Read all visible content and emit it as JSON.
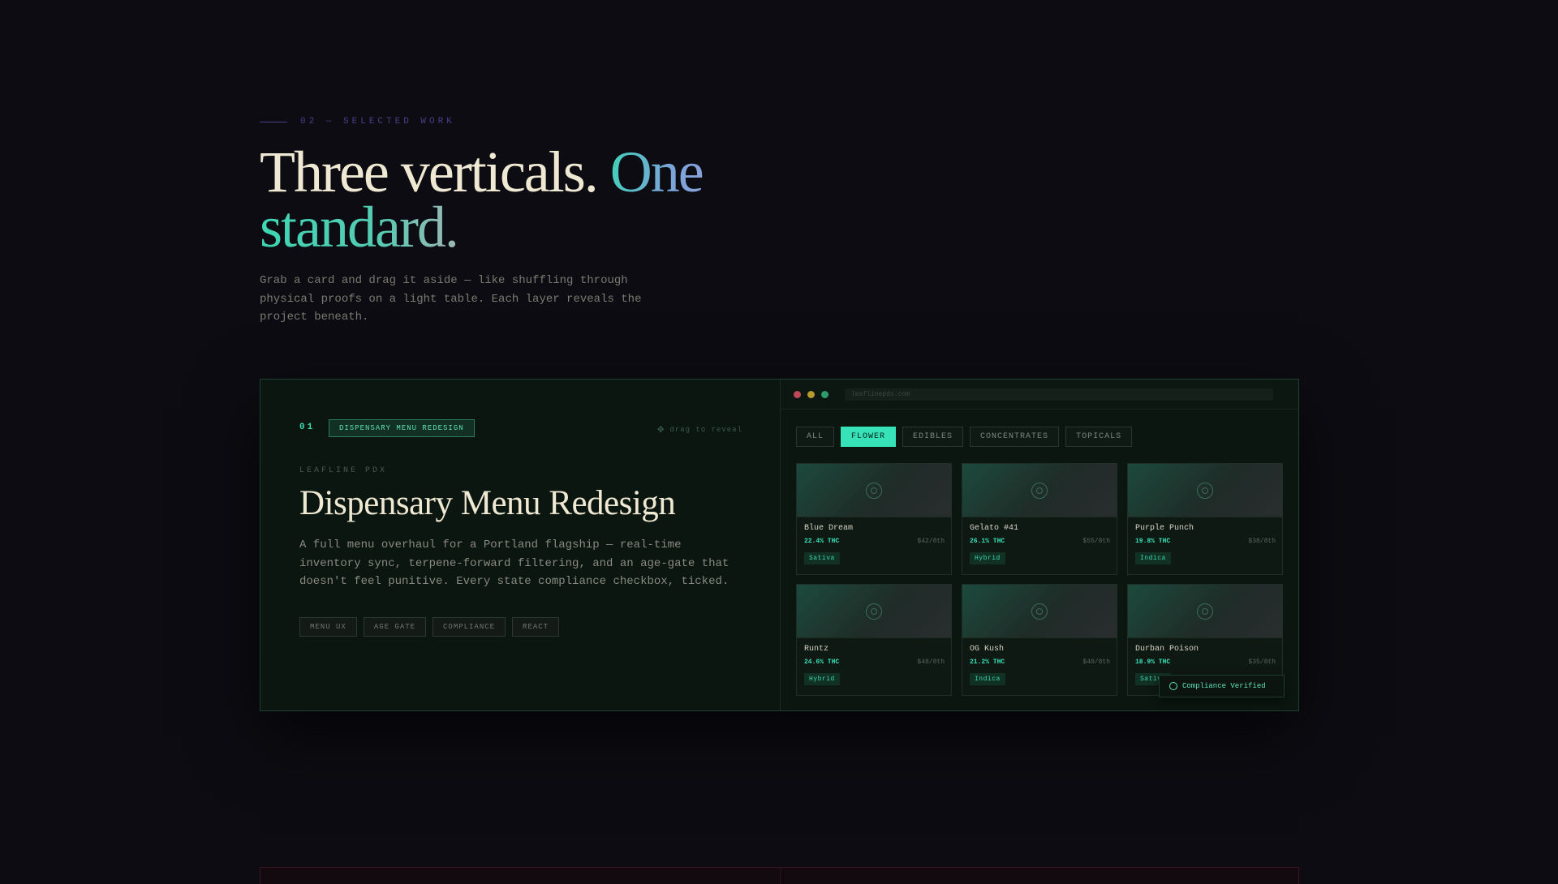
{
  "section": {
    "eyebrow": "02 — SELECTED WORK",
    "headline_part1": "Three verticals. ",
    "headline_part2": "One",
    "headline_part3": "standard.",
    "intro": "Grab a card and drag it aside — like shuffling through physical proofs on a light table. Each layer reveals the project beneath."
  },
  "card": {
    "number": "01",
    "pill": "DISPENSARY MENU REDESIGN",
    "drag_hint": "drag to reveal",
    "client": "LEAFLINE PDX",
    "title": "Dispensary Menu Redesign",
    "description": "A full menu overhaul for a Portland flagship — real-time inventory sync, terpene-forward filtering, and an age-gate that doesn't feel punitive. Every state compliance checkbox, ticked.",
    "tags": [
      "MENU UX",
      "AGE GATE",
      "COMPLIANCE",
      "REACT"
    ]
  },
  "mockup": {
    "url": "leaflinepdx.com",
    "window_dot_colors": [
      "#c0485a",
      "#b99a2e",
      "#2f9b6a"
    ],
    "filters": [
      "ALL",
      "FLOWER",
      "EDIBLES",
      "CONCENTRATES",
      "TOPICALS"
    ],
    "active_filter": "FLOWER",
    "products": [
      {
        "name": "Blue Dream",
        "thc": "22.4% THC",
        "price": "$42/8th",
        "strain": "Sativa"
      },
      {
        "name": "Gelato #41",
        "thc": "26.1% THC",
        "price": "$55/8th",
        "strain": "Hybrid"
      },
      {
        "name": "Purple Punch",
        "thc": "19.8% THC",
        "price": "$38/8th",
        "strain": "Indica"
      },
      {
        "name": "Runtz",
        "thc": "24.6% THC",
        "price": "$48/8th",
        "strain": "Hybrid"
      },
      {
        "name": "OG Kush",
        "thc": "21.2% THC",
        "price": "$40/8th",
        "strain": "Indica"
      },
      {
        "name": "Durban Poison",
        "thc": "18.9% THC",
        "price": "$35/8th",
        "strain": "Sativa"
      }
    ],
    "verified_badge": "Compliance Verified"
  },
  "colors": {
    "accent": "#37e2b8",
    "background": "#0c0c12",
    "card_bg": "#0b1610"
  }
}
